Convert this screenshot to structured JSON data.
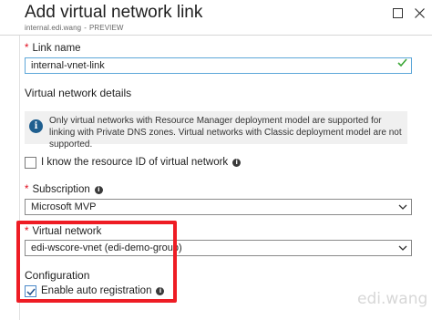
{
  "header": {
    "title": "Add virtual network link",
    "subtitle_zone": "internal.edi.wang",
    "subtitle_sep": "-",
    "subtitle_tag": "PREVIEW"
  },
  "link_name": {
    "label": "Link name",
    "value": "internal-vnet-link"
  },
  "vnet_details": {
    "title": "Virtual network details",
    "info": "Only virtual networks with Resource Manager deployment model are supported for linking with Private DNS zones. Virtual networks with Classic deployment model are not supported.",
    "know_resource_id_label": "I know the resource ID of virtual network"
  },
  "subscription": {
    "label": "Subscription",
    "value": "Microsoft MVP"
  },
  "virtual_network": {
    "label": "Virtual network",
    "value": "edi-wscore-vnet (edi-demo-group)"
  },
  "configuration": {
    "title": "Configuration",
    "auto_registration_label": "Enable auto registration",
    "auto_registration_checked": true
  },
  "watermark": "edi.wang",
  "icons": {
    "maximize": "maximize-icon",
    "close": "close-icon",
    "info": "info-icon",
    "valid": "checkmark-icon",
    "dropdown": "chevron-down-icon"
  },
  "colors": {
    "required": "#e00b1c",
    "highlight": "#ee1c24",
    "valid_check": "#3aa635",
    "focus_border": "#5ea7d9"
  }
}
